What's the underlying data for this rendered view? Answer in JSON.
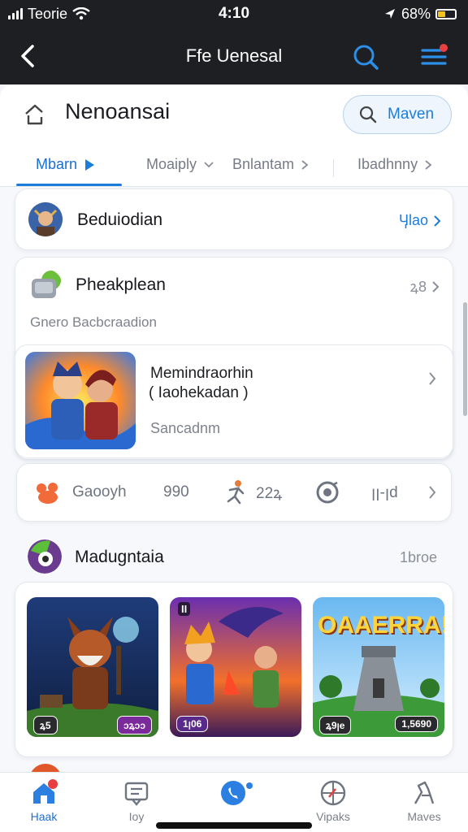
{
  "status_bar": {
    "carrier": "Teorie",
    "time": "4:10",
    "battery": "68%"
  },
  "app_bar": {
    "title": "Ffe Uenesal"
  },
  "header": {
    "title": "Nenoansai",
    "search_label": "Maven"
  },
  "tabs": [
    {
      "label": "Mbarn"
    },
    {
      "label": "Moaiply"
    },
    {
      "label": "Bnlantam"
    },
    {
      "label": "Ibadhnny"
    }
  ],
  "rows": {
    "first": {
      "title": "Beduiodian",
      "trail": "Ӌlao"
    },
    "second": {
      "title": "Pheakplean",
      "trail": "ꝝ8",
      "subtitle": "Gnero Bacbcraadion"
    }
  },
  "feature": {
    "title": "Memindraorhin",
    "subtitle": "( Iaohekadan )",
    "caption": "Sancadnm"
  },
  "stats": [
    {
      "label": "Gaooyh",
      "value": "990"
    },
    {
      "value": "22ꝝ"
    },
    {
      "value": "ꞁꞁ-ꞁd"
    }
  ],
  "section": {
    "title": "Madugntaia",
    "trail": "1broe"
  },
  "games": [
    {
      "title": "",
      "badge_left": "ꝝ5",
      "badge_right": "ɔꝝɔɔ"
    },
    {
      "title": "",
      "badge_left": "1ꞁ06",
      "badge_right": ""
    },
    {
      "title": "OAAERRA!",
      "badge_left": "ꝝ9ꞁe",
      "badge_right": "1,5690"
    }
  ],
  "bottom_nav": [
    {
      "label": "Haak",
      "icon": "home-icon"
    },
    {
      "label": "Ioy",
      "icon": "message-icon"
    },
    {
      "label": "",
      "icon": "phone-icon"
    },
    {
      "label": "Vipaks",
      "icon": "compass-icon"
    },
    {
      "label": "Maves",
      "icon": "game-icon"
    }
  ],
  "colors": {
    "accent": "#1a7ddc",
    "app_bar": "#1e1f22",
    "badge": "#e84040"
  }
}
